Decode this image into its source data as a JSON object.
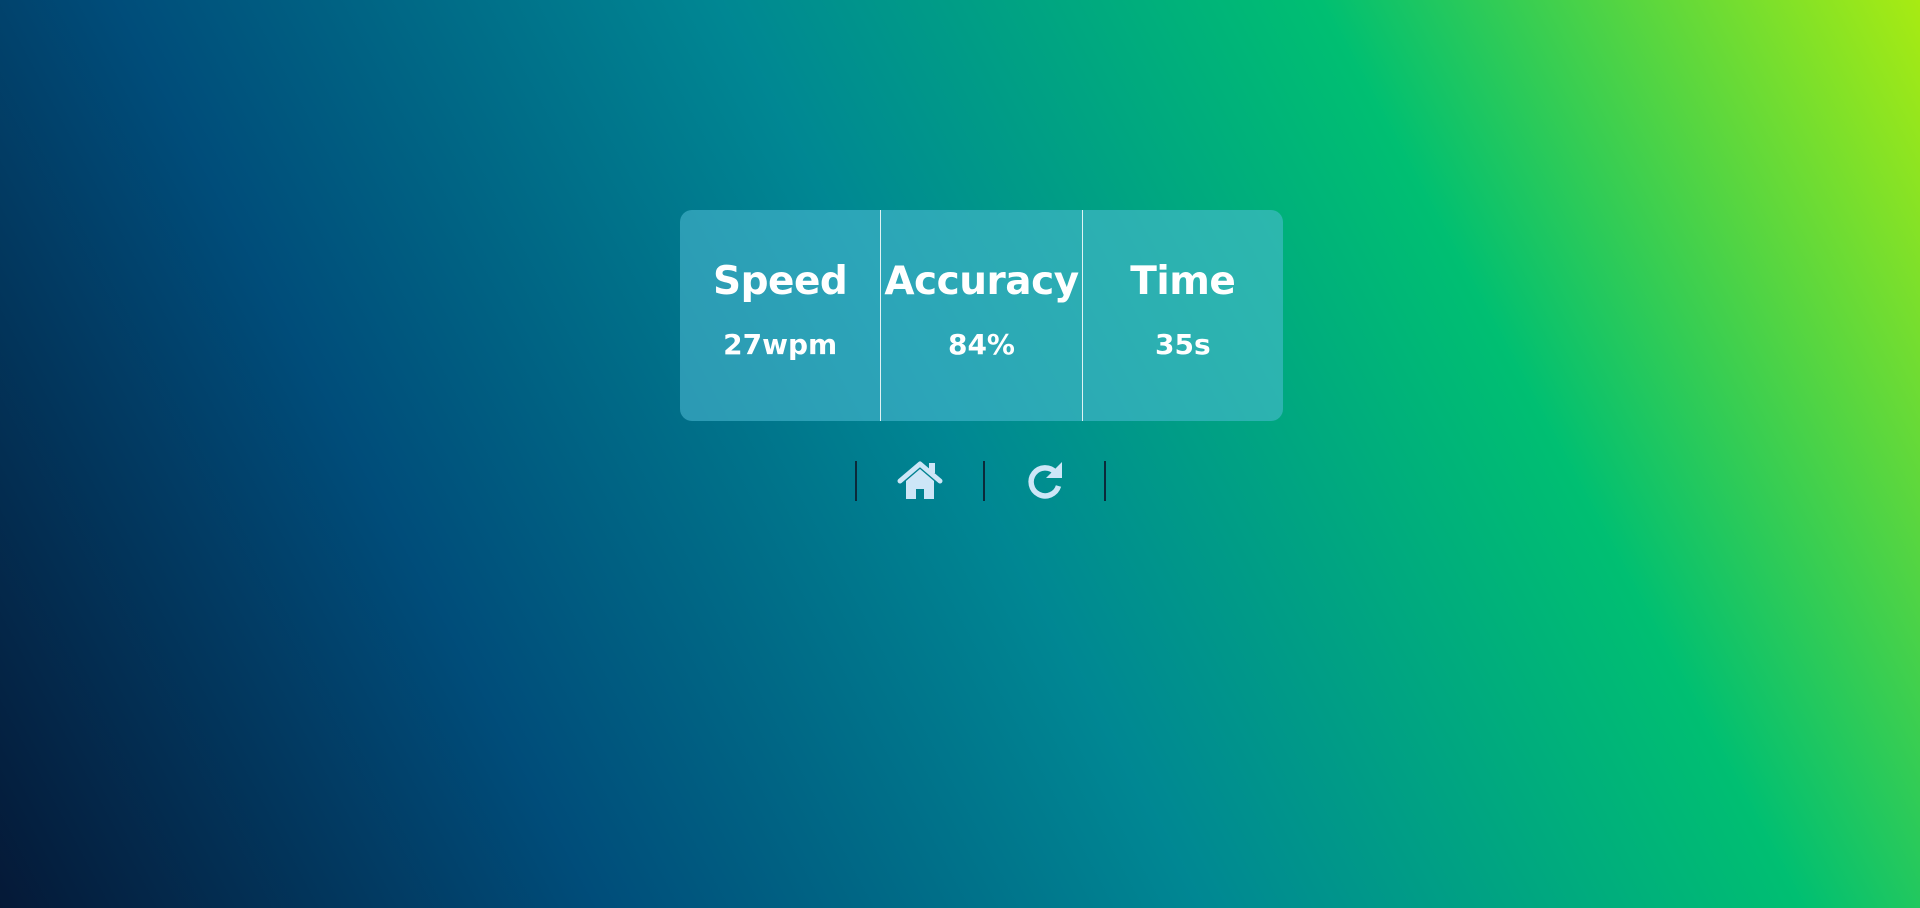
{
  "stats": [
    {
      "label": "Speed",
      "value": "27wpm"
    },
    {
      "label": "Accuracy",
      "value": "84%"
    },
    {
      "label": "Time",
      "value": "35s"
    }
  ],
  "controls": {
    "home_icon": "home-icon",
    "restart_icon": "redo-icon"
  },
  "colors": {
    "background_gradient": [
      "#051937",
      "#004d7a",
      "#008793",
      "#00bf72",
      "#a8eb12"
    ],
    "card_background": "#50bed7",
    "icon_color": "#cde6f7",
    "text_color": "#ffffff"
  }
}
